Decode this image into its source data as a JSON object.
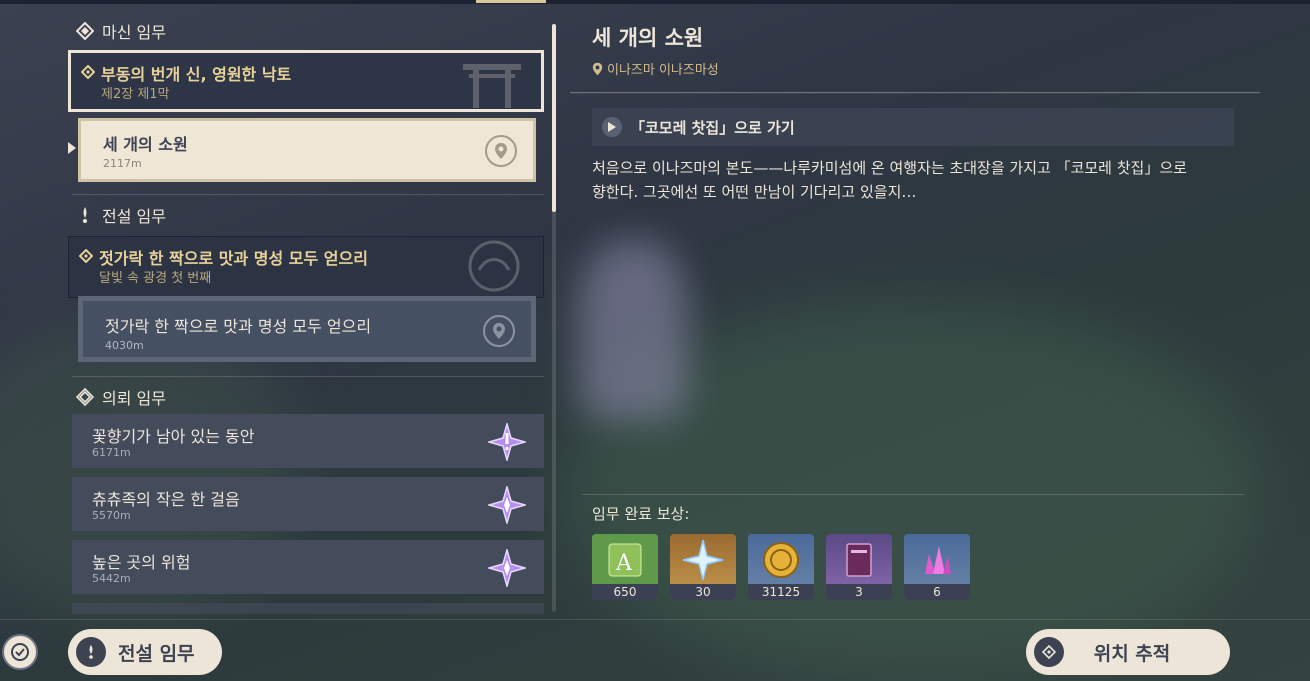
{
  "sections": {
    "archon": {
      "title": "마신 임무"
    },
    "legend": {
      "title": "전설 임무"
    },
    "commission": {
      "title": "의뢰 임무"
    }
  },
  "archon_quest": {
    "title": "부동의 번개 신, 영원한 낙토",
    "subtitle": "제2장 제1막",
    "step": {
      "title": "세 개의 소원",
      "distance": "2117m"
    }
  },
  "legend_quest": {
    "title": "젓가락 한 짝으로 맛과 명성 모두 얻으리",
    "subtitle": "달빛 속 광경 첫 번째",
    "step": {
      "title": "젓가락 한 짝으로 맛과 명성 모두 얻으리",
      "distance": "4030m"
    }
  },
  "commissions": [
    {
      "title": "꽃향기가 남아 있는 동안",
      "distance": "6171m",
      "icon": "commission-exclaim-icon"
    },
    {
      "title": "츄츄족의 작은 한 걸음",
      "distance": "5570m",
      "icon": "commission-star-icon"
    },
    {
      "title": "높은 곳의 위험",
      "distance": "5442m",
      "icon": "commission-star-icon"
    }
  ],
  "detail": {
    "title": "세 개의 소원",
    "location": "이나즈마 이나즈마성",
    "objective": "「코모레 찻집」으로 가기",
    "description": "처음으로 이나즈마의 본도——나루카미섬에 온 여행자는 초대장을 가지고 「코모레 찻집」으로 향한다. 그곳에선 또 어떤 만남이 기다리고 있을지…",
    "rewards_title": "임무 완료 보상:",
    "rewards": [
      {
        "icon": "adventure-exp-icon",
        "count": "650"
      },
      {
        "icon": "primogem-icon",
        "count": "30"
      },
      {
        "icon": "mora-icon",
        "count": "31125"
      },
      {
        "icon": "heros-wit-book-icon",
        "count": "3"
      },
      {
        "icon": "mystic-ore-crystal-icon",
        "count": "6"
      }
    ]
  },
  "buttons": {
    "legend": "전설 임무",
    "track": "위치 추적"
  },
  "colors": {
    "gold": "#e9d29a",
    "cream": "#ece5d8",
    "panel": "#444c5c"
  }
}
